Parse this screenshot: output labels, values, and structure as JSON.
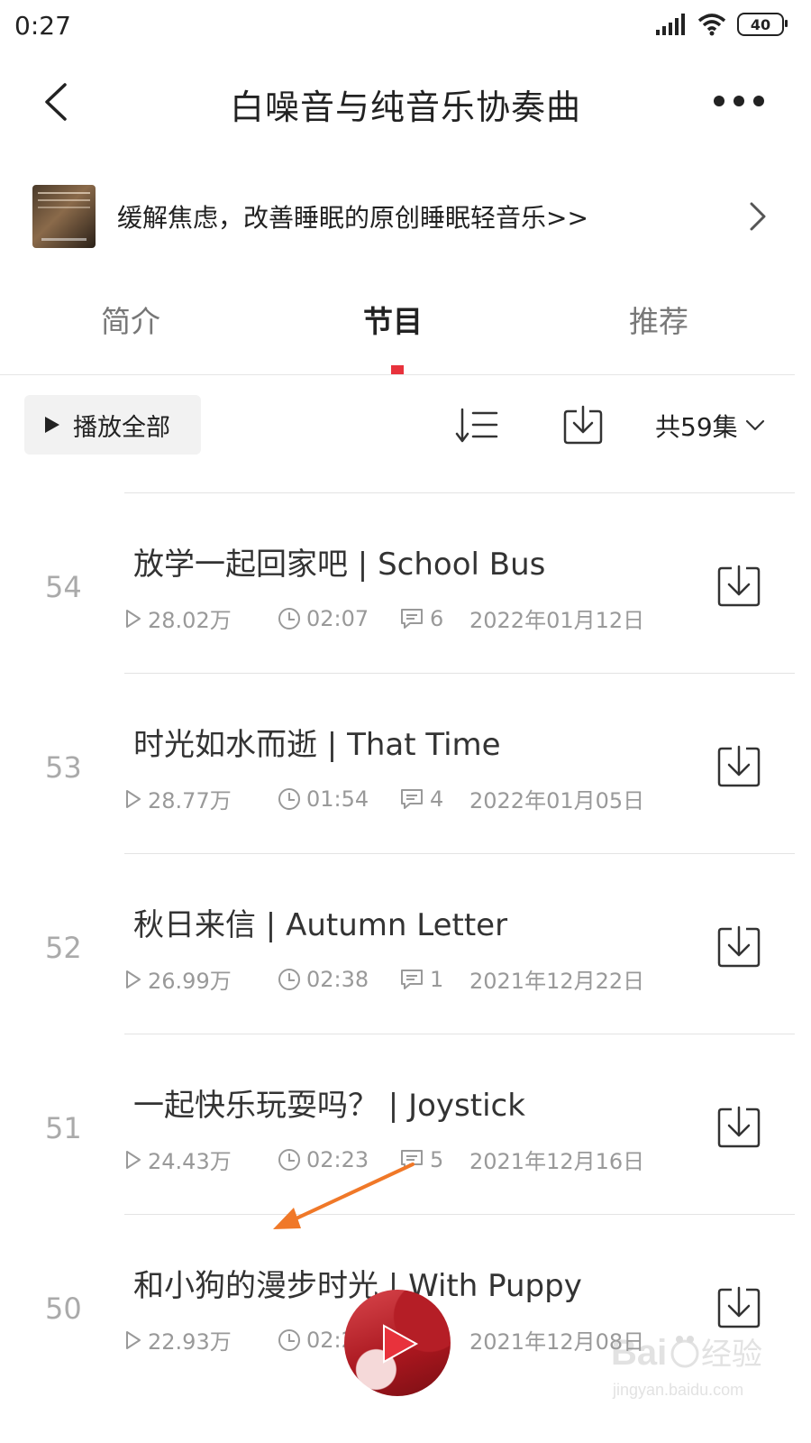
{
  "status_bar": {
    "time": "0:27",
    "battery": "40"
  },
  "nav": {
    "title": "白噪音与纯音乐协奏曲"
  },
  "banner": {
    "text": "缓解焦虑，改善睡眠的原创睡眠轻音乐>>"
  },
  "tabs": [
    {
      "label": "简介",
      "active": false
    },
    {
      "label": "节目",
      "active": true
    },
    {
      "label": "推荐",
      "active": false
    }
  ],
  "toolbar": {
    "play_all_label": "播放全部",
    "episode_count_label": "共59集"
  },
  "episodes": [
    {
      "index": "54",
      "title": "放学一起回家吧 | School Bus",
      "plays": "28.02万",
      "duration": "02:07",
      "comments": "6",
      "date": "2022年01月12日"
    },
    {
      "index": "53",
      "title": "时光如水而逝 | That Time",
      "plays": "28.77万",
      "duration": "01:54",
      "comments": "4",
      "date": "2022年01月05日"
    },
    {
      "index": "52",
      "title": "秋日来信 | Autumn Letter",
      "plays": "26.99万",
      "duration": "02:38",
      "comments": "1",
      "date": "2021年12月22日"
    },
    {
      "index": "51",
      "title": "一起快乐玩耍吗？ | Joystick",
      "plays": "24.43万",
      "duration": "02:23",
      "comments": "5",
      "date": "2021年12月16日"
    },
    {
      "index": "50",
      "title": "和小狗的漫步时光 | With Puppy",
      "plays": "22.93万",
      "duration": "02:2",
      "comments": "",
      "date": "2021年12月08日"
    }
  ],
  "colors": {
    "accent": "#e8323c",
    "annotation_arrow": "#f07828"
  },
  "watermark": {
    "brand": "Baidu经验",
    "url": "jingyan.baidu.com"
  }
}
